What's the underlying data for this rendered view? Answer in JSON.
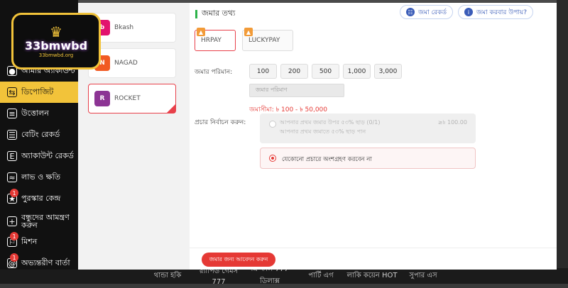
{
  "sidebar": {
    "logo": {
      "brand": "33bmwbd",
      "sub": "33bmwbd.org"
    },
    "items": [
      {
        "label": "আমার অ্যাকাউন্ট",
        "icon": "user-icon",
        "active": false
      },
      {
        "label": "ডিপোজিট",
        "icon": "deposit-icon",
        "active": true
      },
      {
        "label": "উত্তোলন",
        "icon": "withdraw-icon",
        "active": false
      },
      {
        "label": "বেটিং রেকর্ড",
        "icon": "betting-record-icon",
        "active": false
      },
      {
        "label": "অ্যাকাউন্ট রেকর্ড",
        "icon": "account-record-icon",
        "active": false
      },
      {
        "label": "লাভ ও ক্ষতি",
        "icon": "profit-loss-icon",
        "active": false
      },
      {
        "label": "পুরস্কার কেন্দ্র",
        "icon": "reward-icon",
        "badge": "1",
        "active": false
      },
      {
        "label": "বন্ধুদের আমন্ত্রণ করুন",
        "icon": "invite-icon",
        "active": false
      },
      {
        "label": "মিশন",
        "icon": "mission-icon",
        "badge": "1",
        "active": false
      },
      {
        "label": "অভ্যন্তরীণ বার্তা",
        "icon": "message-icon",
        "badge": "1",
        "active": false
      }
    ]
  },
  "payment_methods": [
    {
      "label": "Bkash",
      "color": "#e2136e",
      "short": "b"
    },
    {
      "label": "NAGAD",
      "color": "#f15a22",
      "short": "N"
    },
    {
      "label": "ROCKET",
      "color": "#8c3494",
      "short": "R",
      "selected": true
    }
  ],
  "header": {
    "title": "জমার তথ্য",
    "record_button": "জমা রেকর্ড",
    "howto_button": "জমা করবার উপায়?"
  },
  "channels": [
    {
      "label": "HRPAY",
      "active": true
    },
    {
      "label": "LUCKYPAY",
      "active": false
    }
  ],
  "amount": {
    "label": "জমার পরিমান:",
    "presets": [
      "100",
      "200",
      "500",
      "1,000",
      "3,000"
    ],
    "placeholder": "জমার পরিমাণ",
    "limit": "জমাসীমা: ৳ 100 - ৳ 50,000"
  },
  "promo": {
    "label": "প্রচার নির্বাচন করুন:",
    "option1_line1": "আপনার প্রথম জমার উপর ৫৩% ছাড় (0/1)",
    "option1_line2": "আপনার প্রথম জমাতে ৫৩% ছাড় পান",
    "option1_value": "≥৳ 100.00",
    "option2": "যেকোনো প্রচারে অংশগ্রহণ করবেন না"
  },
  "submit_label": "জমার জন্য আবেদন করুন",
  "bottom_nav": [
    "থান্ডা হকি",
    "র‍্যাপিড গেমস 777",
    "ক্রিস্টাল 777 ডিলাক্স",
    "পার্টি এগ",
    "লাকি কয়েন HOT",
    "সুপার এস"
  ]
}
